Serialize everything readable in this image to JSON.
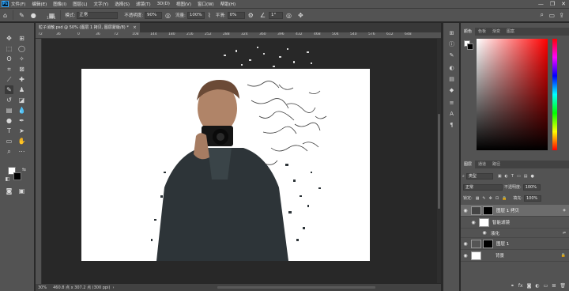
{
  "menu": {
    "logo": "Ps",
    "items": [
      "文件(F)",
      "编辑(E)",
      "图像(I)",
      "图层(L)",
      "文字(Y)",
      "选择(S)",
      "滤镜(T)",
      "3D(D)",
      "视图(V)",
      "窗口(W)",
      "帮助(H)"
    ],
    "minimize": "—",
    "restore": "❐",
    "close": "✕"
  },
  "options": {
    "brush_size": "1381",
    "mode_label": "模式:",
    "mode_value": "正常",
    "opacity_label": "不透明度:",
    "opacity_value": "90%",
    "flow_label": "流量:",
    "flow_value": "100%",
    "smoothing_label": "平滑:",
    "smoothing_value": "0%",
    "angle_value": "1°"
  },
  "document": {
    "tab_title": "粒子消散.psd @ 50% (图层 1 拷贝, 图层蒙版/8) *",
    "tab_close": "×",
    "ruler_ticks": [
      "72",
      "36",
      "0",
      "36",
      "72",
      "108",
      "144",
      "180",
      "216",
      "252",
      "288",
      "324",
      "360",
      "396",
      "432",
      "468",
      "504",
      "540",
      "576",
      "612",
      "648"
    ],
    "zoom": "30%",
    "dimensions": "460.8 点 x 307.2 点 (300 ppi)"
  },
  "color_panel": {
    "tabs": [
      "颜色",
      "色板",
      "渐变",
      "图案"
    ]
  },
  "layers_panel": {
    "tabs": [
      "图层",
      "通道",
      "路径"
    ],
    "filter_kind": "类型",
    "blend_mode": "正常",
    "opacity_label": "不透明度:",
    "opacity_value": "100%",
    "lock_label": "锁定:",
    "fill_label": "填充:",
    "fill_value": "100%",
    "layers": [
      {
        "name": "图层 1 拷贝",
        "selected": true
      },
      {
        "name": "智能滤镜",
        "selected": false
      },
      {
        "name": "液化",
        "selected": false
      },
      {
        "name": "图层 1",
        "selected": false
      },
      {
        "name": "背景",
        "selected": false
      }
    ],
    "footer_icons": [
      "link-icon",
      "fx-icon",
      "mask-icon",
      "adjustment-icon",
      "group-icon",
      "new-layer-icon",
      "trash-icon"
    ]
  }
}
